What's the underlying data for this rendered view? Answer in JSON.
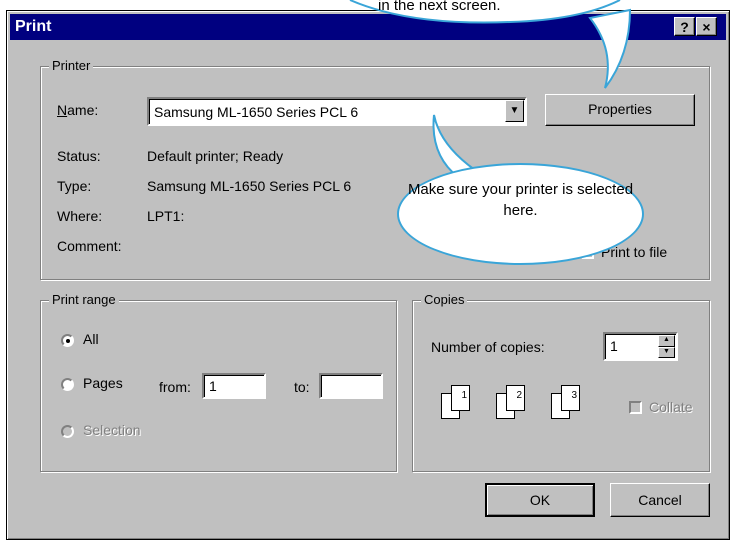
{
  "dialog": {
    "title": "Print",
    "help_btn": "?",
    "close_btn": "×"
  },
  "callouts": {
    "top_text": "in the next screen.",
    "bubble_text": "Make sure your printer is selected here."
  },
  "printer": {
    "legend": "Printer",
    "name_label": "Name:",
    "name_value": "Samsung ML-1650 Series PCL 6",
    "properties_label": "Properties",
    "status_label": "Status:",
    "status_value": "Default printer; Ready",
    "type_label": "Type:",
    "type_value": "Samsung ML-1650 Series PCL 6",
    "where_label": "Where:",
    "where_value": "LPT1:",
    "comment_label": "Comment:",
    "print_to_file_label": "Print to file"
  },
  "print_range": {
    "legend": "Print range",
    "all_label": "All",
    "pages_label": "Pages",
    "from_label": "from:",
    "from_value": "1",
    "to_label": "to:",
    "to_value": "",
    "selection_label": "Selection"
  },
  "copies": {
    "legend": "Copies",
    "number_label": "Number of copies:",
    "number_value": "1",
    "collate_label": "Collate",
    "page_numbers": [
      "1",
      "1",
      "2",
      "2",
      "3",
      "3"
    ]
  },
  "buttons": {
    "ok": "OK",
    "cancel": "Cancel"
  }
}
